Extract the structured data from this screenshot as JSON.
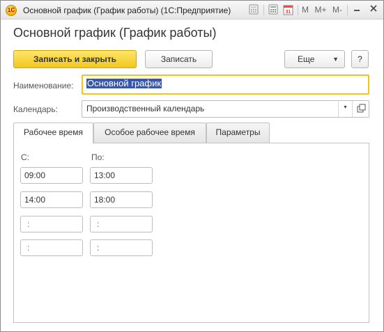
{
  "window": {
    "title": "Основной график (График работы)  (1С:Предприятие)",
    "logo_text": "1С",
    "titlebar_icons": [
      "calculator-icon",
      "calendar-icon"
    ],
    "calendar_day": "31",
    "mem_buttons": [
      "M",
      "M+",
      "M-"
    ],
    "window_controls": [
      "minimize-icon",
      "close-icon"
    ]
  },
  "form": {
    "title": "Основной график (График работы)"
  },
  "toolbar": {
    "save_close_label": "Записать и закрыть",
    "save_label": "Записать",
    "more_label": "Еще",
    "help_label": "?"
  },
  "fields": {
    "name_label": "Наименование:",
    "name_value": "Основной график",
    "calendar_label": "Календарь:",
    "calendar_value": "Производственный календарь"
  },
  "tabs": [
    {
      "label": "Рабочее время",
      "active": true
    },
    {
      "label": "Особое рабочее время",
      "active": false
    },
    {
      "label": "Параметры",
      "active": false
    }
  ],
  "work_time": {
    "from_label": "С:",
    "to_label": "По:",
    "rows": [
      {
        "from": "09:00",
        "to": "13:00"
      },
      {
        "from": "14:00",
        "to": "18:00"
      },
      {
        "from": " :",
        "to": " :"
      },
      {
        "from": " :",
        "to": " :"
      }
    ]
  }
}
